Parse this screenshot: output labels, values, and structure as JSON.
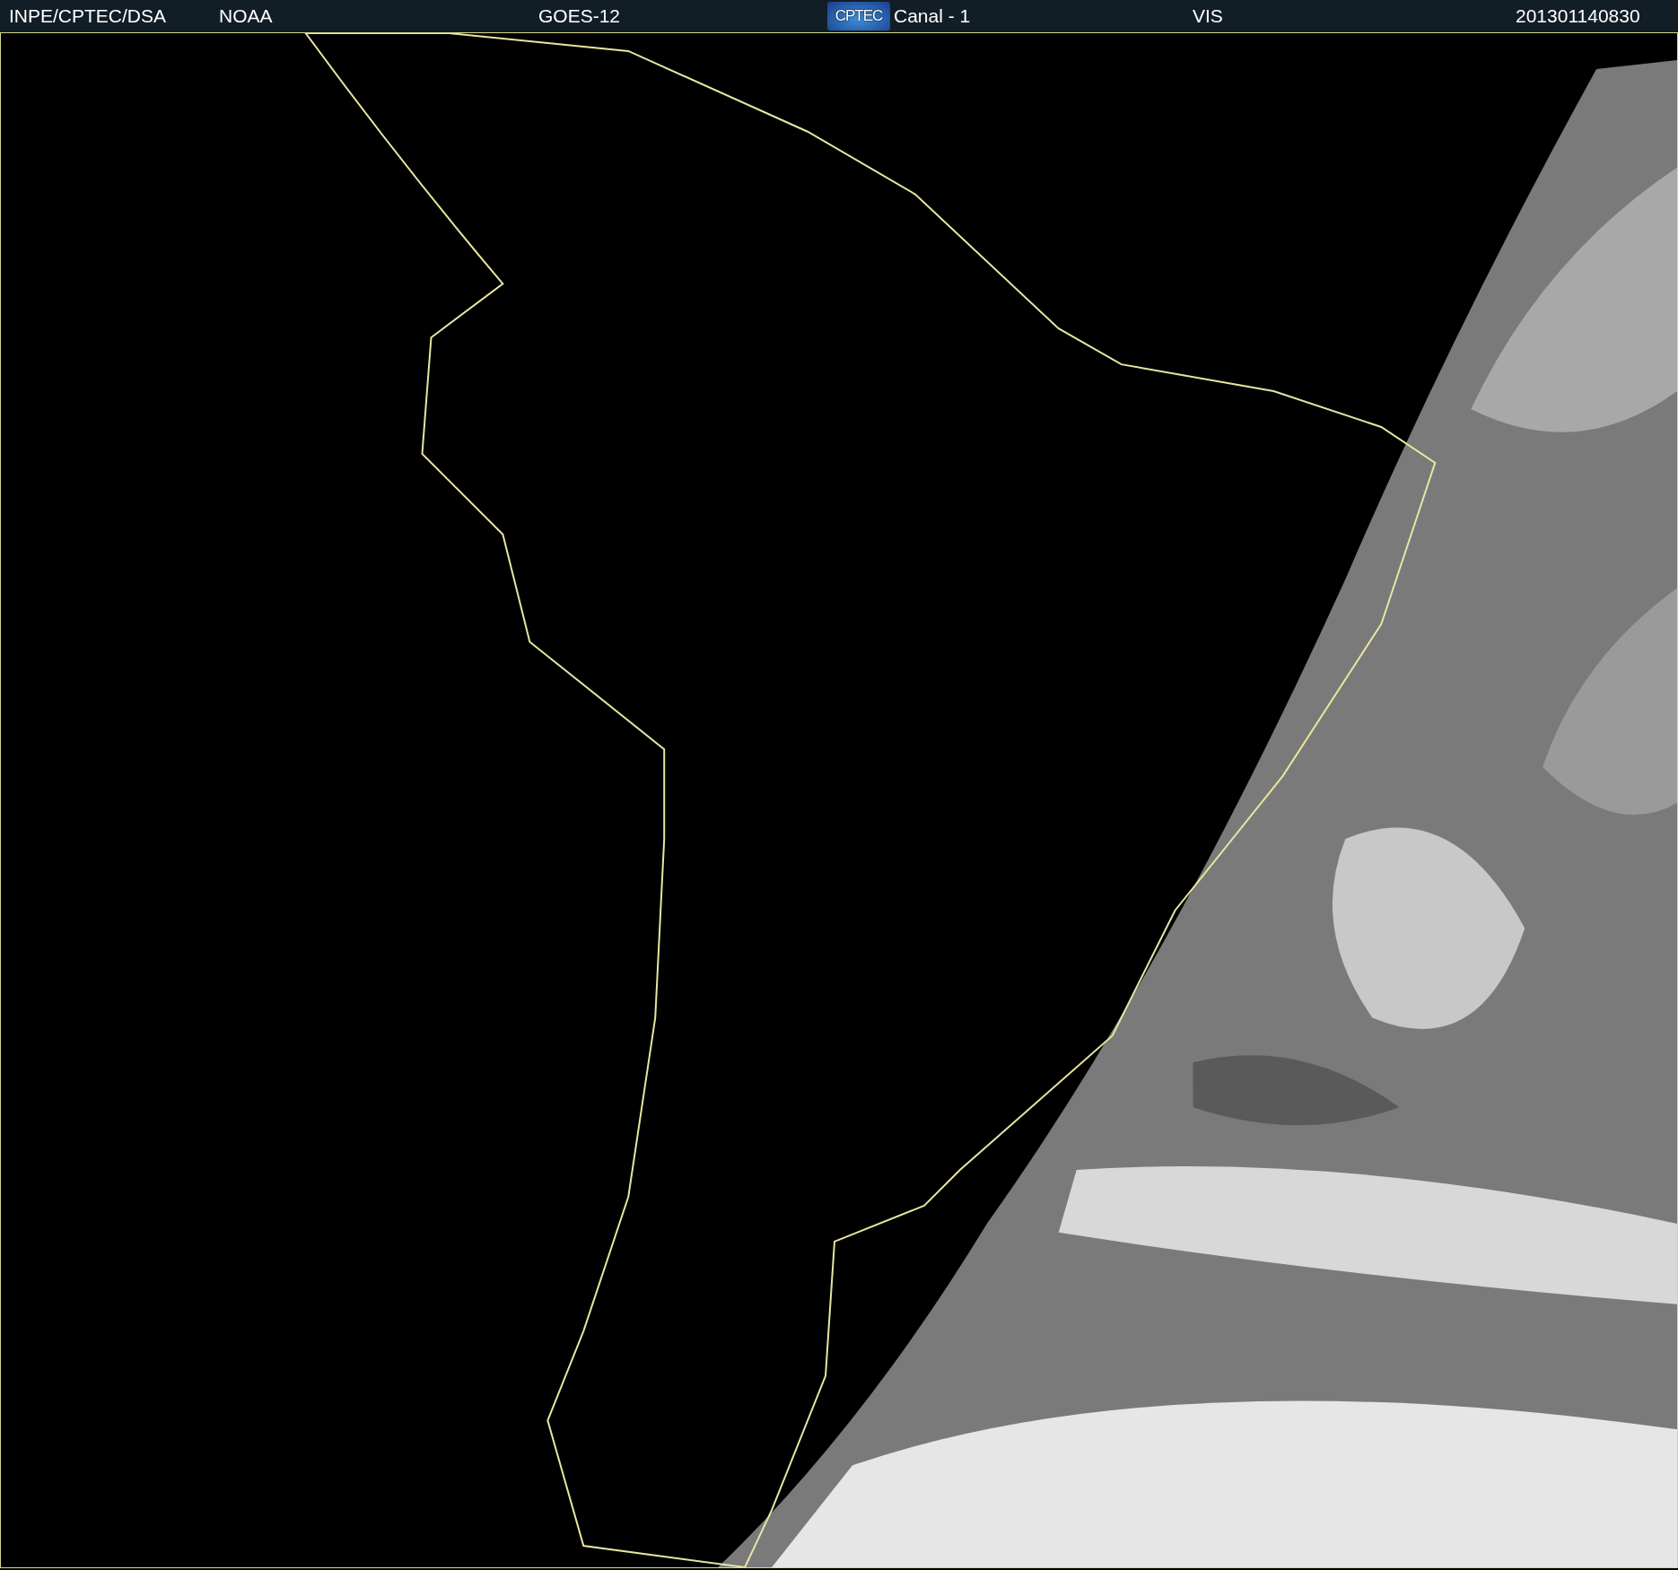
{
  "header": {
    "source": "INPE/CPTEC/DSA",
    "agency": "NOAA",
    "satellite": "GOES-12",
    "logo": "CPTEC",
    "channel": "Canal - 1",
    "band": "VIS",
    "timestamp": "201301140830"
  }
}
